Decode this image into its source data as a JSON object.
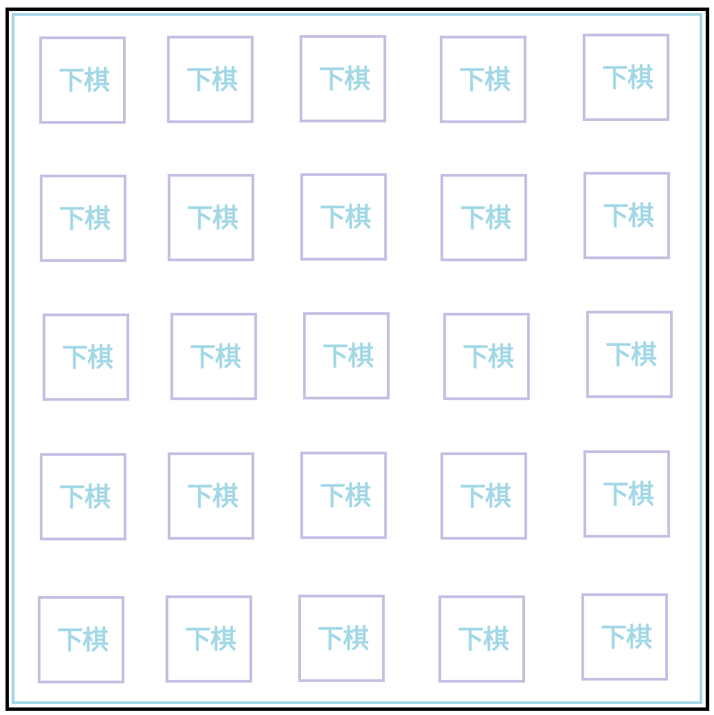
{
  "board": {
    "rows": 5,
    "cols": 5,
    "cell_label": "下棋",
    "cells": [
      [
        "下棋",
        "下棋",
        "下棋",
        "下棋",
        "下棋"
      ],
      [
        "下棋",
        "下棋",
        "下棋",
        "下棋",
        "下棋"
      ],
      [
        "下棋",
        "下棋",
        "下棋",
        "下棋",
        "下棋"
      ],
      [
        "下棋",
        "下棋",
        "下棋",
        "下棋",
        "下棋"
      ],
      [
        "下棋",
        "下棋",
        "下棋",
        "下棋",
        "下棋"
      ]
    ]
  },
  "colors": {
    "outer_border": "#000000",
    "inner_border": "#a3d8e6",
    "cell_border": "#c7bfe3",
    "cell_text": "#a3d8e6",
    "background": "#ffffff"
  }
}
